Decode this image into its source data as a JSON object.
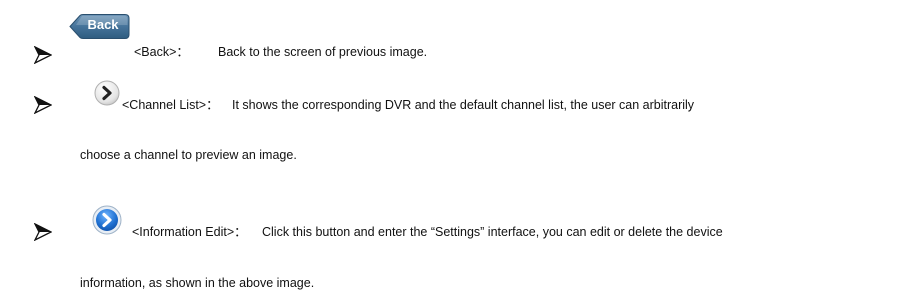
{
  "items": [
    {
      "icon": "back-button-icon",
      "icon_label": "Back",
      "label": "<Back>：",
      "desc_line1": "Back to the screen of previous image."
    },
    {
      "icon": "chevron-right-grey-circle-icon",
      "label": "<Channel List>：",
      "desc_line1": "It shows the corresponding DVR and the default channel list, the user can arbitrarily",
      "desc_line2": "choose a channel to preview an image."
    },
    {
      "icon": "chevron-right-blue-circle-icon",
      "label": "<Information Edit>：",
      "desc_line1": "Click this button and enter the “Settings” interface, you can edit or delete the device",
      "desc_line2": "information, as shown in the above image."
    }
  ],
  "colors": {
    "back_button": "#3f6f93",
    "blue_icon": "#1e6fd0",
    "grey_icon": "#d9d9d9"
  }
}
